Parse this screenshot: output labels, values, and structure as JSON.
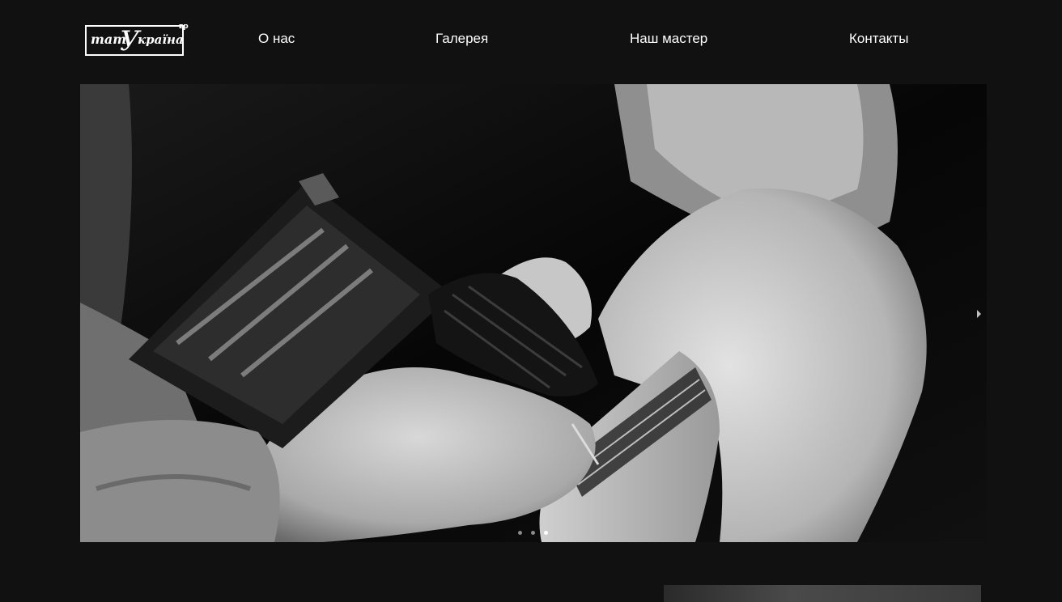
{
  "header": {
    "logo_text": "тат Україна",
    "logo_suffix": "zp",
    "nav": [
      {
        "label": "О нас"
      },
      {
        "label": "Галерея"
      },
      {
        "label": "Наш мастер"
      },
      {
        "label": "Контакты"
      }
    ]
  },
  "slider": {
    "image_icon": "tattoo-photo",
    "slide_count": 3,
    "active_slide": 3
  },
  "colors": {
    "background": "#111111",
    "text": "#ffffff"
  }
}
